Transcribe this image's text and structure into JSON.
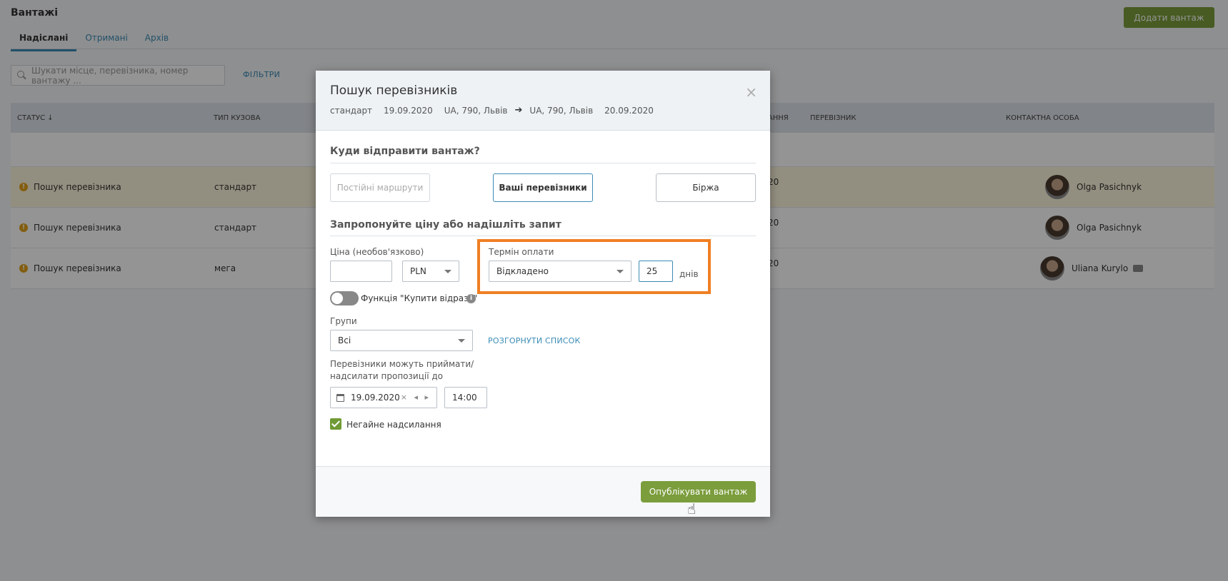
{
  "page": {
    "title": "Вантажі",
    "add_button": "Додати вантаж",
    "tabs": [
      "Надіслані",
      "Отримані",
      "Архів"
    ],
    "search_placeholder": "Шукати місце, перевізника, номер вантажу ...",
    "filters": "ФІЛЬТРИ"
  },
  "grid": {
    "headers": {
      "status": "СТАТУС ↓",
      "body_type": "ТИП КУЗОВА",
      "unloading": "ВАННЯ",
      "carrier": "ПЕРЕВІЗНИК",
      "contact": "КОНТАКТНА ОСОБА"
    },
    "rows": [
      {
        "status": "Пошук перевізника",
        "body_type": "стандарт",
        "date": "20",
        "contact": "Olga Pasichnyk"
      },
      {
        "status": "Пошук перевізника",
        "body_type": "стандарт",
        "date": "20",
        "contact": "Olga Pasichnyk"
      },
      {
        "status": "Пошук перевізника",
        "body_type": "мега",
        "date": "20",
        "contact": "Uliana Kurylo"
      }
    ]
  },
  "modal": {
    "title": "Пошук перевізників",
    "close": "×",
    "subtitle": {
      "body_type": "стандарт",
      "load_date": "19.09.2020",
      "from": "UA, 790, Львів",
      "arrow": "➔",
      "to": "UA, 790, Львів",
      "unload_date": "20.09.2020"
    },
    "section_where": "Куди відправити вантаж?",
    "destinations": {
      "routes": "Постійні маршрути",
      "your_carriers": "Ваші перевізники",
      "exchange": "Біржа"
    },
    "section_price": "Запропонуйте ціну або надішліть запит",
    "price_label": "Ціна (необов'язково)",
    "price_value": "",
    "currency": "PLN",
    "payment_label": "Термін оплати",
    "payment_value": "Відкладено",
    "payment_days": "25",
    "days_unit": "днів",
    "buy_now_label": "Функція \"Купити відразу\"",
    "groups_label": "Групи",
    "groups_value": "Всі",
    "expand_list": "РОЗГОРНУТИ СПИСОК",
    "deadline_label_1": "Перевізники можуть приймати/",
    "deadline_label_2": "надсилати пропозиції до",
    "deadline_date": "19.09.2020",
    "deadline_date_ctrl": "× ◂ ▸",
    "deadline_time": "14:00",
    "immediate_label": "Негайне надсилання",
    "publish": "Опублікувати вантаж"
  },
  "colors": {
    "accent_green": "#7b9d3c",
    "link_blue": "#3b8bb5",
    "highlight_orange": "#f07f23"
  }
}
